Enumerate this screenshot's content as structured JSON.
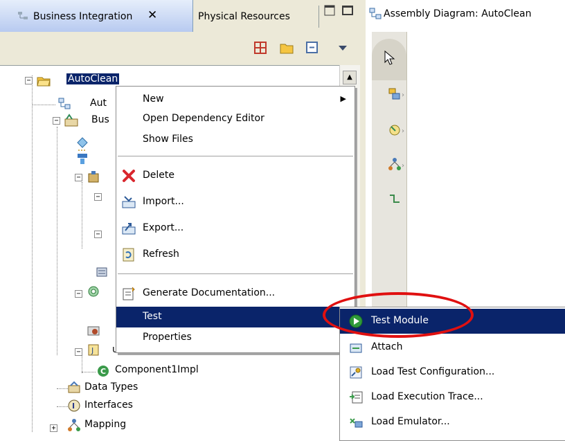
{
  "tabs": {
    "business_integration": "Business Integration",
    "physical_resources": "Physical Resources",
    "close": "✕"
  },
  "editor": {
    "title": "Assembly Diagram: AutoClean"
  },
  "tree": {
    "root": "AutoClean",
    "row_aut": "Aut",
    "row_bus": "Bus",
    "component": "Component1Impl",
    "data_types": "Data Types",
    "interfaces": "Interfaces",
    "mapping": "Mapping",
    "hidden_suffix": "uru"
  },
  "context_menu": {
    "items": [
      {
        "label": "New",
        "has_submenu": true
      },
      {
        "label": "Open Dependency Editor"
      },
      {
        "label": "Show Files"
      },
      {
        "label": "Delete",
        "icon": "red-x-icon"
      },
      {
        "label": "Import...",
        "icon": "import-icon"
      },
      {
        "label": "Export...",
        "icon": "export-icon"
      },
      {
        "label": "Refresh",
        "icon": "refresh-icon"
      },
      {
        "label": "Generate Documentation...",
        "icon": "document-icon"
      },
      {
        "label": "Test",
        "has_submenu": true,
        "selected": true
      },
      {
        "label": "Properties"
      }
    ]
  },
  "submenu": {
    "items": [
      {
        "label": "Test Module",
        "selected": true,
        "icon": "play-icon"
      },
      {
        "label": "Attach",
        "icon": "attach-icon"
      },
      {
        "label": "Load Test Configuration...",
        "icon": "config-icon"
      },
      {
        "label": "Load Execution Trace...",
        "icon": "trace-icon"
      },
      {
        "label": "Load Emulator...",
        "icon": "emulator-icon"
      }
    ]
  },
  "colors": {
    "selection": "#0a246a",
    "highlight_ring": "#e01010",
    "panel_bg": "#ece9d8"
  }
}
